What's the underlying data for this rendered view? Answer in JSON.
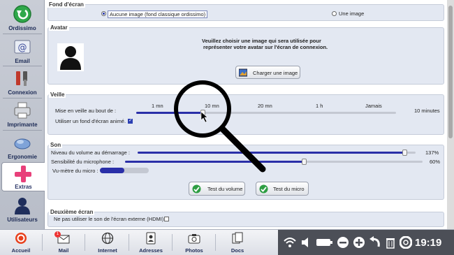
{
  "sidebar": {
    "items": [
      {
        "label": "Ordissimo",
        "icon": "back-arrow-icon"
      },
      {
        "label": "Email",
        "icon": "email-icon"
      },
      {
        "label": "Connexion",
        "icon": "tools-icon"
      },
      {
        "label": "Imprimante",
        "icon": "printer-icon"
      },
      {
        "label": "Ergonomie",
        "icon": "ergonomy-icon"
      },
      {
        "label": "Extras",
        "icon": "plus-icon",
        "active": true
      },
      {
        "label": "Utilisateurs",
        "icon": "user-icon"
      }
    ]
  },
  "fond": {
    "title": "Fond d'écran",
    "option_none": "Aucune image (fond classique ordissimo)",
    "option_image": "Une image",
    "selected": "Aucune image (fond classique ordissimo)"
  },
  "avatar": {
    "title": "Avatar",
    "description_line1": "Veuillez choisir une image qui sera utilisée pour",
    "description_line2": "représenter votre avatar sur l'écran de connexion.",
    "button_label": "Charger une image"
  },
  "veille": {
    "title": "Veille",
    "label": "Mise en veille au bout de :",
    "ticks": [
      "1 mn",
      "10 mn",
      "20 mn",
      "1 h",
      "Jamais"
    ],
    "value": "10 minutes",
    "animated_label": "Utiliser un fond d'écran animé.",
    "animated_checked": true
  },
  "son": {
    "title": "Son",
    "volume_label": "Niveau du volume au démarrage :",
    "volume_value": "137%",
    "volume_fraction": 0.96,
    "micro_label": "Sensibilité du microphone :",
    "micro_value": "60%",
    "micro_fraction": 0.6,
    "vumeter_label": "Vu-mètre du micro :",
    "vumeter_fraction": 0.5,
    "test_volume": "Test du volume",
    "test_micro": "Test du micro"
  },
  "second_screen": {
    "title": "Deuxième écran",
    "hdmi_label": "Ne pas utiliser le son de l'écran externe (HDMI)",
    "hdmi_checked": false
  },
  "taskbar": {
    "items": [
      {
        "label": "Accueil",
        "icon": "ordissimo-logo-icon"
      },
      {
        "label": "Mail",
        "icon": "mail-icon",
        "badge": "1"
      },
      {
        "label": "Internet",
        "icon": "globe-icon"
      },
      {
        "label": "Adresses",
        "icon": "address-book-icon"
      },
      {
        "label": "Photos",
        "icon": "camera-icon"
      },
      {
        "label": "Docs",
        "icon": "documents-icon"
      }
    ],
    "clock": "19:19"
  },
  "colors": {
    "accent": "#2a2fa8",
    "sidebar_bg": "#c1c6d0",
    "tray_bg": "#4c4f57"
  }
}
